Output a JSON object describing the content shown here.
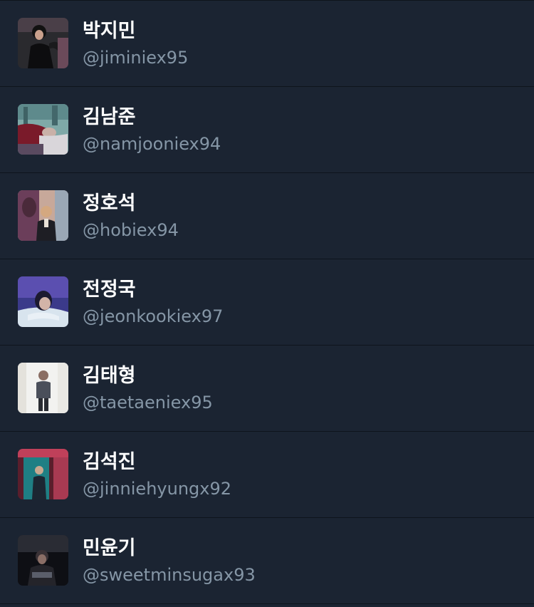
{
  "users": [
    {
      "name": "박지민",
      "handle": "@jiminiex95",
      "avatar": "avatar-photo-1"
    },
    {
      "name": "김남준",
      "handle": "@namjooniex94",
      "avatar": "avatar-photo-2"
    },
    {
      "name": "정호석",
      "handle": "@hobiex94",
      "avatar": "avatar-photo-3"
    },
    {
      "name": "전정국",
      "handle": "@jeonkookiex97",
      "avatar": "avatar-photo-4"
    },
    {
      "name": "김태형",
      "handle": "@taetaeniex95",
      "avatar": "avatar-photo-5"
    },
    {
      "name": "김석진",
      "handle": "@jinniehyungx92",
      "avatar": "avatar-photo-6"
    },
    {
      "name": "민윤기",
      "handle": "@sweetminsugax93",
      "avatar": "avatar-photo-7"
    }
  ],
  "colors": {
    "background": "#1b2432",
    "divider": "#0e141c",
    "name_text": "#ffffff",
    "handle_text": "#8596a6"
  }
}
